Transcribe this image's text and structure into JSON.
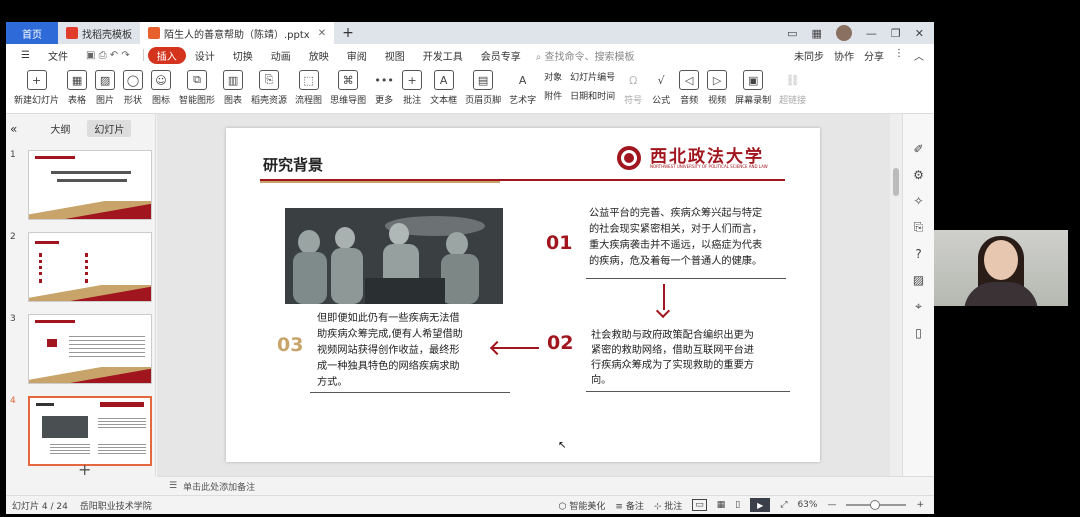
{
  "tabs": {
    "home": "首页",
    "template": "找稻壳模板",
    "doc": "陌生人的善意帮助（陈靖）.pptx"
  },
  "menu": {
    "file": "文件",
    "items": [
      "插入",
      "设计",
      "切换",
      "动画",
      "放映",
      "审阅",
      "视图",
      "开发工具",
      "会员专享"
    ],
    "search": "查找命令、搜索模板",
    "right": [
      "未同步",
      "协作",
      "分享"
    ]
  },
  "ribbon": {
    "buttons": [
      "新建幻灯片",
      "表格",
      "图片",
      "形状",
      "图标",
      "智能图形",
      "图表",
      "稻壳资源",
      "流程图",
      "思维导图",
      "更多",
      "批注",
      "文本框",
      "页眉页脚",
      "艺术字"
    ],
    "group1": [
      "对象",
      "附件"
    ],
    "group2": [
      "幻灯片编号",
      "日期和时间"
    ],
    "buttons2": [
      "符号",
      "公式",
      "音频",
      "视频",
      "屏幕录制",
      "超链接"
    ]
  },
  "leftpanel": {
    "tab_outline": "大纲",
    "tab_slides": "幻灯片",
    "thumbs": [
      "1",
      "2",
      "3",
      "4"
    ]
  },
  "slide": {
    "title": "研究背景",
    "university": "西北政法大学",
    "university_en": "NORTHWEST UNIVERSITY OF POLITICAL SCIENCE AND LAW",
    "n01": "01",
    "p01": [
      "公益平台的完善、疾病众筹兴起与特定",
      "的社会现实紧密相关，对于人们而言，",
      "重大疾病袭击并不遥远，以癌症为代表",
      "的疾病，危及着每一个普通人的健康。"
    ],
    "n02": "02",
    "p02": [
      "社会救助与政府政策配合编织出更为",
      "紧密的救助网络，借助互联网平台进",
      "行疾病众筹成为了实现救助的重要方",
      "向。"
    ],
    "n03": "03",
    "p03": [
      "但即便如此仍有一些疾病无法借",
      "助疾病众筹完成,便有人希望借助",
      "视频网站获得创作收益，最终形",
      "成一种独具特色的网络疾病求助",
      "方式。"
    ]
  },
  "notes": {
    "placeholder": "单击此处添加备注"
  },
  "status": {
    "slide_info": "幻灯片 4 / 24",
    "school": "岳阳职业技术学院",
    "beautify": "智能美化",
    "notes": "备注",
    "comments": "批注",
    "zoom": "63%"
  },
  "colors": {
    "brand_red": "#a0151e",
    "gold": "#c8a46a",
    "accent_blue": "#2e6bd8"
  }
}
